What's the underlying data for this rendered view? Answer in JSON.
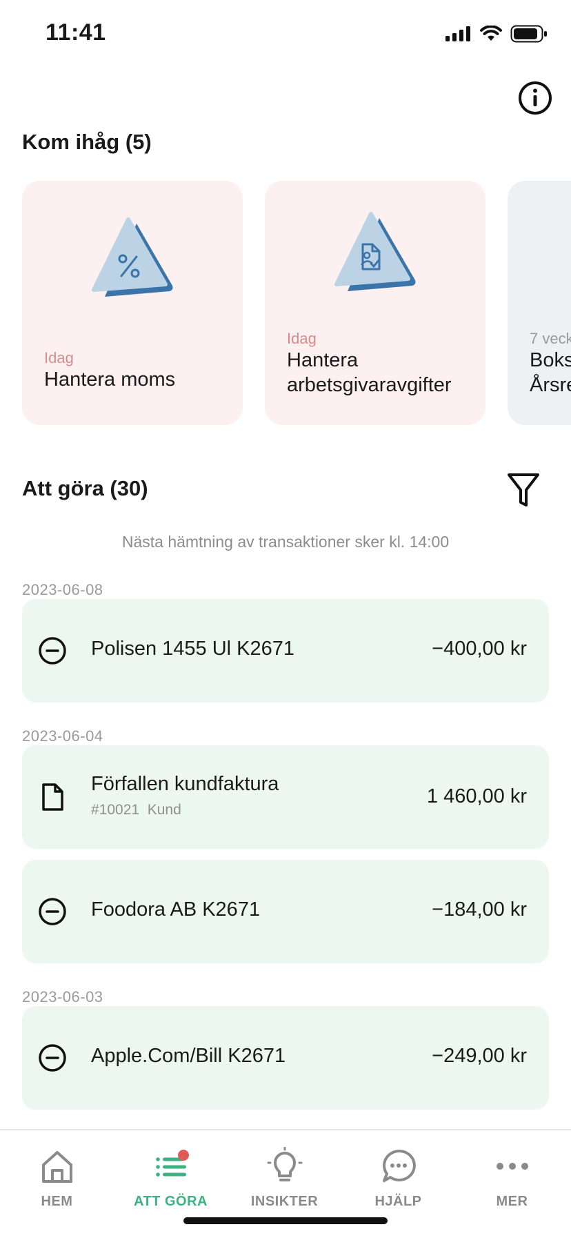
{
  "status_bar": {
    "time": "11:41"
  },
  "reminders": {
    "title": "Kom ihåg (5)",
    "cards": [
      {
        "when": "Idag",
        "title": "Hantera moms",
        "icon": "percent-icon"
      },
      {
        "when": "Idag",
        "title": "Hantera arbetsgivaravgifter",
        "icon": "document-check-icon"
      },
      {
        "when": "7 veck",
        "title_line1": "Boks",
        "title_line2": "Årsre",
        "icon": "document-icon"
      }
    ]
  },
  "todo": {
    "title": "Att göra (30)",
    "fetch_note": "Nästa hämtning av transaktioner sker kl. 14:00",
    "groups": [
      {
        "date": "2023-06-08",
        "items": [
          {
            "name": "Polisen 1455 Ul K2671",
            "amount": "−400,00 kr",
            "icon": "minus-circle-icon"
          }
        ]
      },
      {
        "date": "2023-06-04",
        "items": [
          {
            "name": "Förfallen kundfaktura",
            "sub_number": "#10021",
            "sub_label": "Kund",
            "amount": "1 460,00 kr",
            "icon": "document-icon"
          },
          {
            "name": "Foodora AB K2671",
            "amount": "−184,00 kr",
            "icon": "minus-circle-icon"
          }
        ]
      },
      {
        "date": "2023-06-03",
        "items": [
          {
            "name": "Apple.Com/Bill K2671",
            "amount": "−249,00 kr",
            "icon": "minus-circle-icon"
          }
        ]
      }
    ]
  },
  "tabbar": {
    "tabs": [
      {
        "label": "HEM",
        "icon": "home-icon",
        "active": false
      },
      {
        "label": "ATT GÖRA",
        "icon": "list-icon",
        "active": true
      },
      {
        "label": "INSIKTER",
        "icon": "lightbulb-icon",
        "active": false
      },
      {
        "label": "HJÄLP",
        "icon": "chat-icon",
        "active": false
      },
      {
        "label": "MER",
        "icon": "more-icon",
        "active": false
      }
    ]
  },
  "colors": {
    "card_red": "#fdf0f0",
    "card_grey": "#eef1f4",
    "when_red": "#d98b8b",
    "tx_bg": "#edf7f1",
    "accent_green": "#3bb27f",
    "badge_red": "#e05a5a",
    "illus_light": "#bcd3e6",
    "illus_dark": "#3b74a8"
  }
}
